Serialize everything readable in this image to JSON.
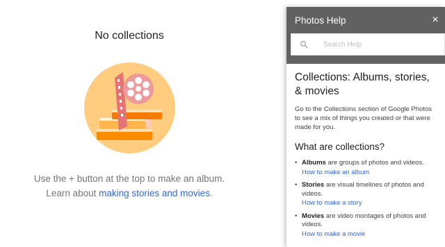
{
  "empty_state": {
    "title": "No collections",
    "hint_line1": "Use the + button at the top to make an album.",
    "hint_line2_prefix": "Learn about ",
    "hint_line2_link": "making stories and movies",
    "hint_line2_suffix": "."
  },
  "help_panel": {
    "title": "Photos Help",
    "close_glyph": "×",
    "search_placeholder": "Search Help",
    "article_title": "Collections: Albums, stories, & movies",
    "article_intro": "Go to the Collections section of Google Photos to see a mix of things you created or that were made for you.",
    "section_heading": "What are collections?",
    "items": [
      {
        "term": "Albums",
        "description": " are groups of photos and videos.",
        "link": "How to make an album"
      },
      {
        "term": "Stories",
        "description": " are visual timelines of photos and videos.",
        "link": "How to make a story"
      },
      {
        "term": "Movies",
        "description": " are video montages of photos and videos.",
        "link": "How to make a movie"
      }
    ]
  },
  "colors": {
    "header_bg": "#616161",
    "link": "#3367d6",
    "illustration_circle": "#ffcc80",
    "film_reel": "#ef9a9a",
    "book_orange": "#fb8c00"
  },
  "icons": {
    "search": "search-icon",
    "close": "close-icon",
    "illustration": "collections-illustration"
  }
}
